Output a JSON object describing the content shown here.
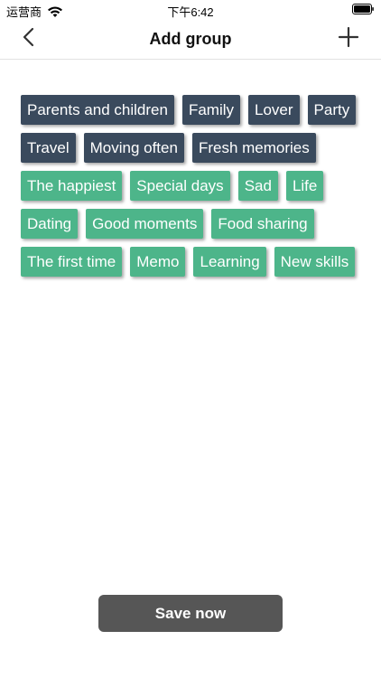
{
  "status_bar": {
    "carrier": "运营商",
    "time": "下午6:42",
    "wifi_icon": "wifi-icon",
    "battery_icon": "battery-icon"
  },
  "nav": {
    "title": "Add group",
    "back_icon": "chevron-left-icon",
    "add_icon": "plus-icon"
  },
  "tags": [
    {
      "label": "Parents and children",
      "style": "dark"
    },
    {
      "label": "Family",
      "style": "dark"
    },
    {
      "label": "Lover",
      "style": "dark"
    },
    {
      "label": "Party",
      "style": "dark"
    },
    {
      "label": "Travel",
      "style": "dark"
    },
    {
      "label": "Moving often",
      "style": "dark"
    },
    {
      "label": "Fresh memories",
      "style": "dark"
    },
    {
      "label": "The happiest",
      "style": "green"
    },
    {
      "label": "Special days",
      "style": "green"
    },
    {
      "label": "Sad",
      "style": "green"
    },
    {
      "label": "Life",
      "style": "green"
    },
    {
      "label": "Dating",
      "style": "green"
    },
    {
      "label": "Good moments",
      "style": "green"
    },
    {
      "label": "Food sharing",
      "style": "green"
    },
    {
      "label": "The first time",
      "style": "green"
    },
    {
      "label": "Memo",
      "style": "green"
    },
    {
      "label": "Learning",
      "style": "green"
    },
    {
      "label": "New skills",
      "style": "green"
    }
  ],
  "colors": {
    "tag_dark": "#3a4a5d",
    "tag_green": "#4db58a",
    "save_button": "#565656"
  },
  "save_label": "Save now"
}
